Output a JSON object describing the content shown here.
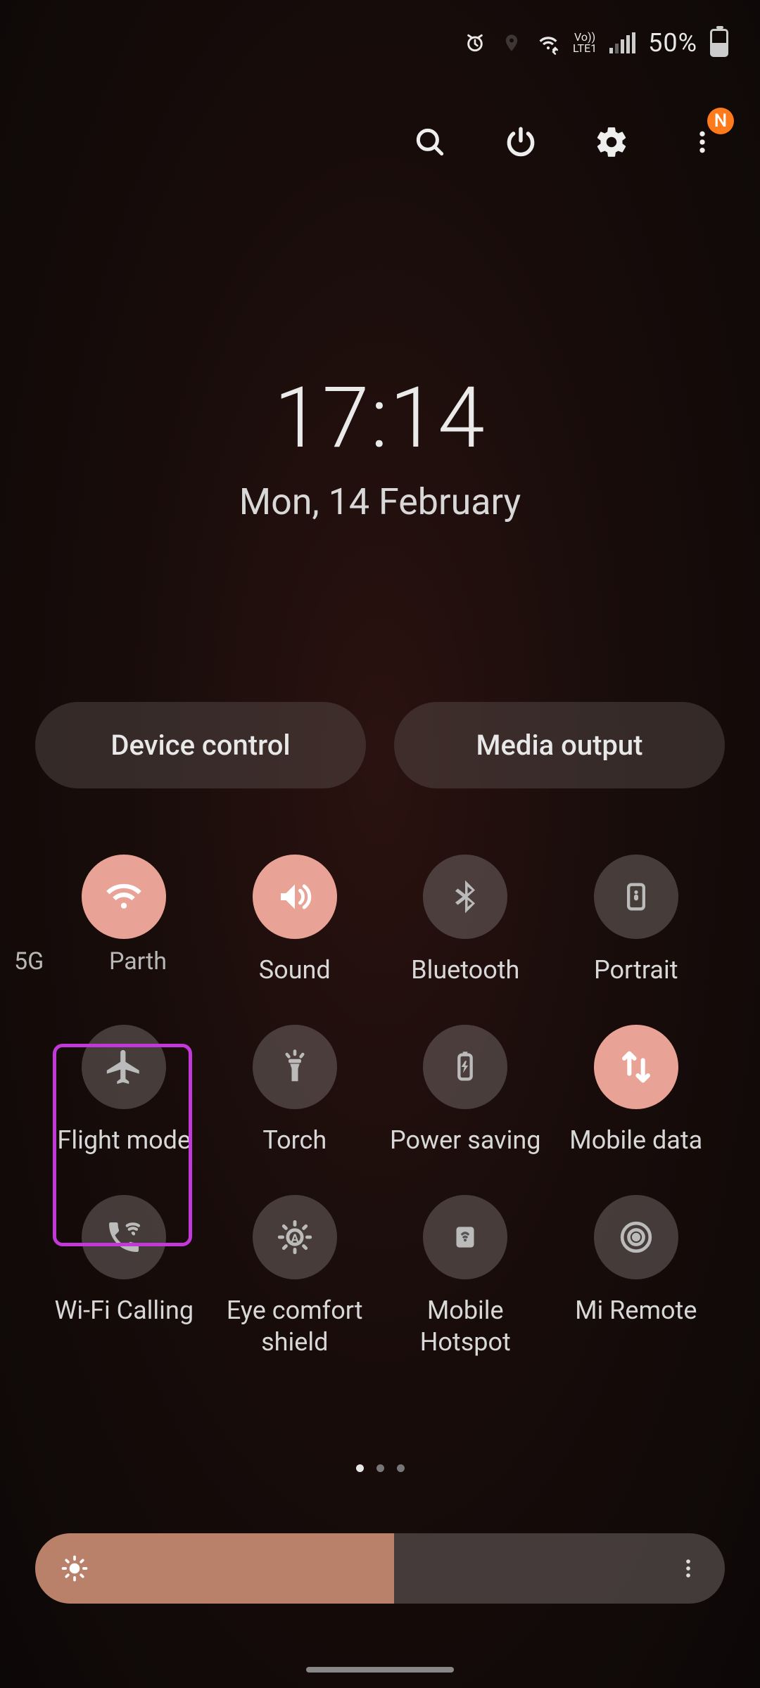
{
  "status": {
    "battery_pct": "50%",
    "volte_top": "Vo))",
    "volte_bot": "LTE1"
  },
  "actions": {
    "badge": "N"
  },
  "clock": {
    "time": "17:14",
    "date": "Mon, 14 February"
  },
  "pills": {
    "device_control": "Device control",
    "media_output": "Media output"
  },
  "tiles": [
    {
      "id": "wifi",
      "label": "Parth",
      "prefix": "5G",
      "active": true,
      "icon": "wifi"
    },
    {
      "id": "sound",
      "label": "Sound",
      "active": true,
      "icon": "sound"
    },
    {
      "id": "bluetooth",
      "label": "Bluetooth",
      "active": false,
      "icon": "bluetooth"
    },
    {
      "id": "portrait",
      "label": "Portrait",
      "active": false,
      "icon": "portrait"
    },
    {
      "id": "flight",
      "label": "Flight mode",
      "active": false,
      "icon": "flight",
      "highlighted": true
    },
    {
      "id": "torch",
      "label": "Torch",
      "active": false,
      "icon": "torch"
    },
    {
      "id": "powersaving",
      "label": "Power saving",
      "active": false,
      "icon": "battery"
    },
    {
      "id": "mobiledata",
      "label": "Mobile data",
      "active": true,
      "icon": "data"
    },
    {
      "id": "wificalling",
      "label": "Wi-Fi Calling",
      "active": false,
      "icon": "wificall"
    },
    {
      "id": "eyecomfort",
      "label": "Eye comfort shield",
      "active": false,
      "icon": "eye"
    },
    {
      "id": "hotspot",
      "label": "Mobile Hotspot",
      "active": false,
      "icon": "hotspot"
    },
    {
      "id": "miremote",
      "label": "Mi Remote",
      "active": false,
      "icon": "remote"
    }
  ],
  "pagination": {
    "count": 3,
    "active": 0
  },
  "brightness": {
    "value_pct": 52
  },
  "colors": {
    "accent_active": "#e9a296",
    "badge": "#ff7a1a",
    "highlight": "#c238d8"
  }
}
